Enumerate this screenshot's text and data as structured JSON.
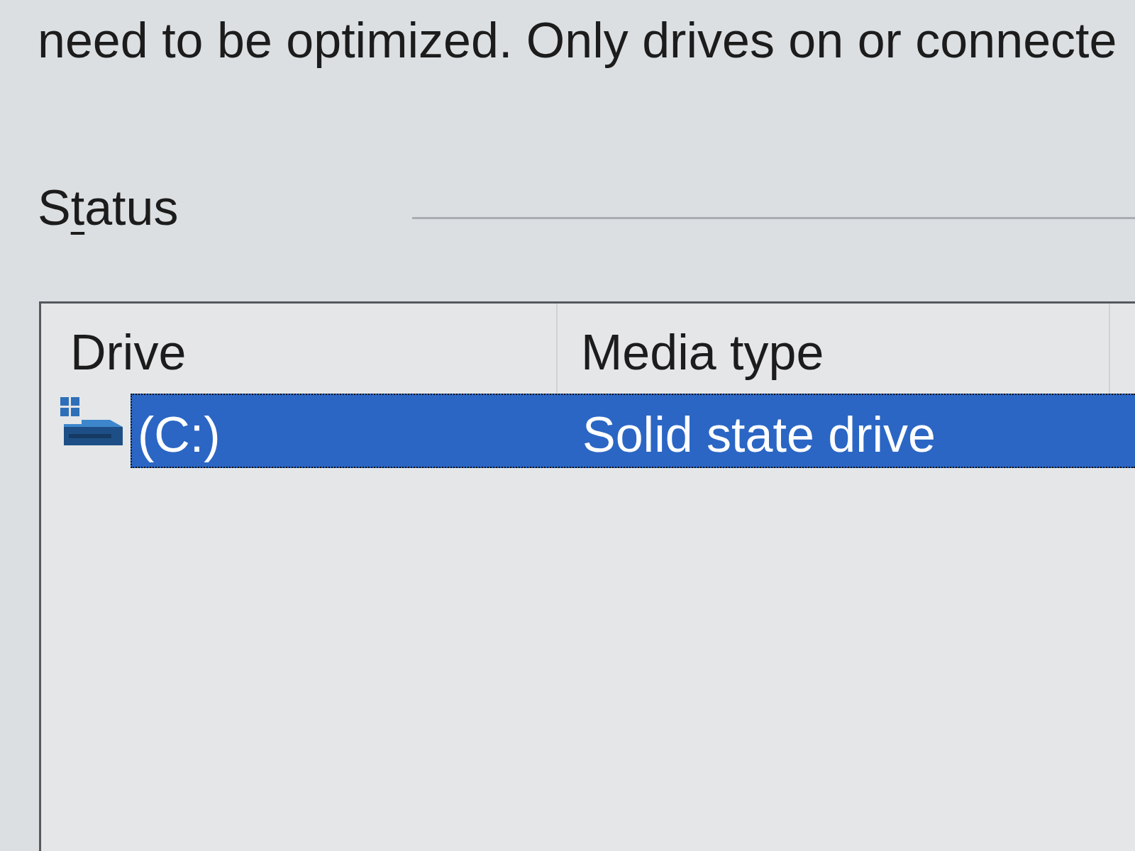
{
  "description": {
    "text": "need to be optimized. Only drives on or connecte"
  },
  "status_group": {
    "label_parts": [
      {
        "text": "S",
        "underlined": false
      },
      {
        "text": "t",
        "underlined": true
      },
      {
        "text": "atus",
        "underlined": false
      }
    ]
  },
  "drive_list": {
    "columns": [
      "Drive",
      "Media type"
    ],
    "rows": [
      {
        "cells": [
          "(C:)",
          "Solid state drive"
        ],
        "selected": true,
        "focused": true
      }
    ]
  }
}
